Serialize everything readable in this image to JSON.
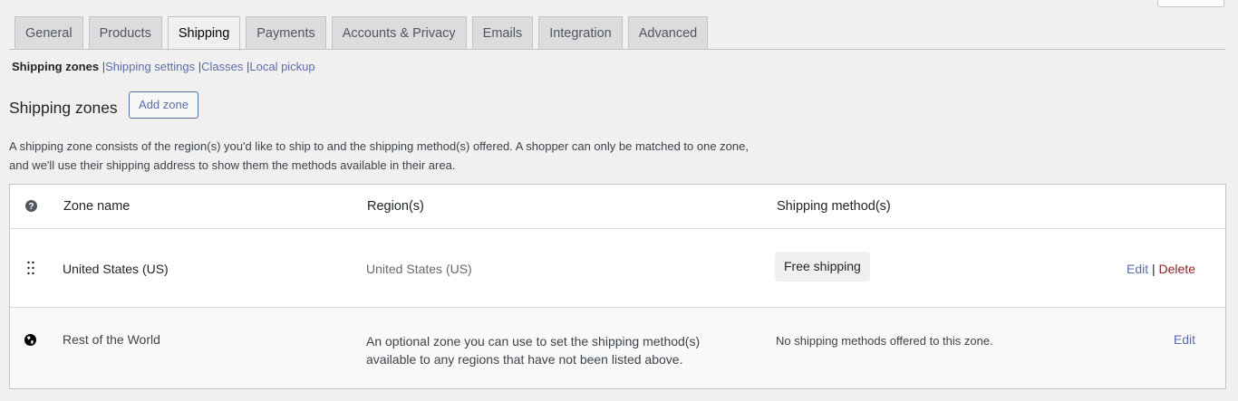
{
  "tabs": [
    "General",
    "Products",
    "Shipping",
    "Payments",
    "Accounts & Privacy",
    "Emails",
    "Integration",
    "Advanced"
  ],
  "active_tab": "Shipping",
  "subnav": {
    "current": "Shipping zones",
    "links": [
      "Shipping settings",
      "Classes",
      "Local pickup"
    ],
    "sep": "|"
  },
  "heading": "Shipping zones",
  "add_zone": "Add zone",
  "description": "A shipping zone consists of the region(s) you'd like to ship to and the shipping method(s) offered. A shopper can only be matched to one zone, and we'll use their shipping address to show them the methods available in their area.",
  "table": {
    "headers": {
      "zone": "Zone name",
      "regions": "Region(s)",
      "methods": "Shipping method(s)"
    },
    "rows": [
      {
        "zone": "United States (US)",
        "region": "United States (US)",
        "method": "Free shipping",
        "edit": "Edit",
        "sep": "|",
        "delete": "Delete"
      },
      {
        "zone": "Rest of the World",
        "region": "An optional zone you can use to set the shipping method(s) available to any regions that have not been listed above.",
        "method": "No shipping methods offered to this zone.",
        "edit": "Edit"
      }
    ]
  }
}
